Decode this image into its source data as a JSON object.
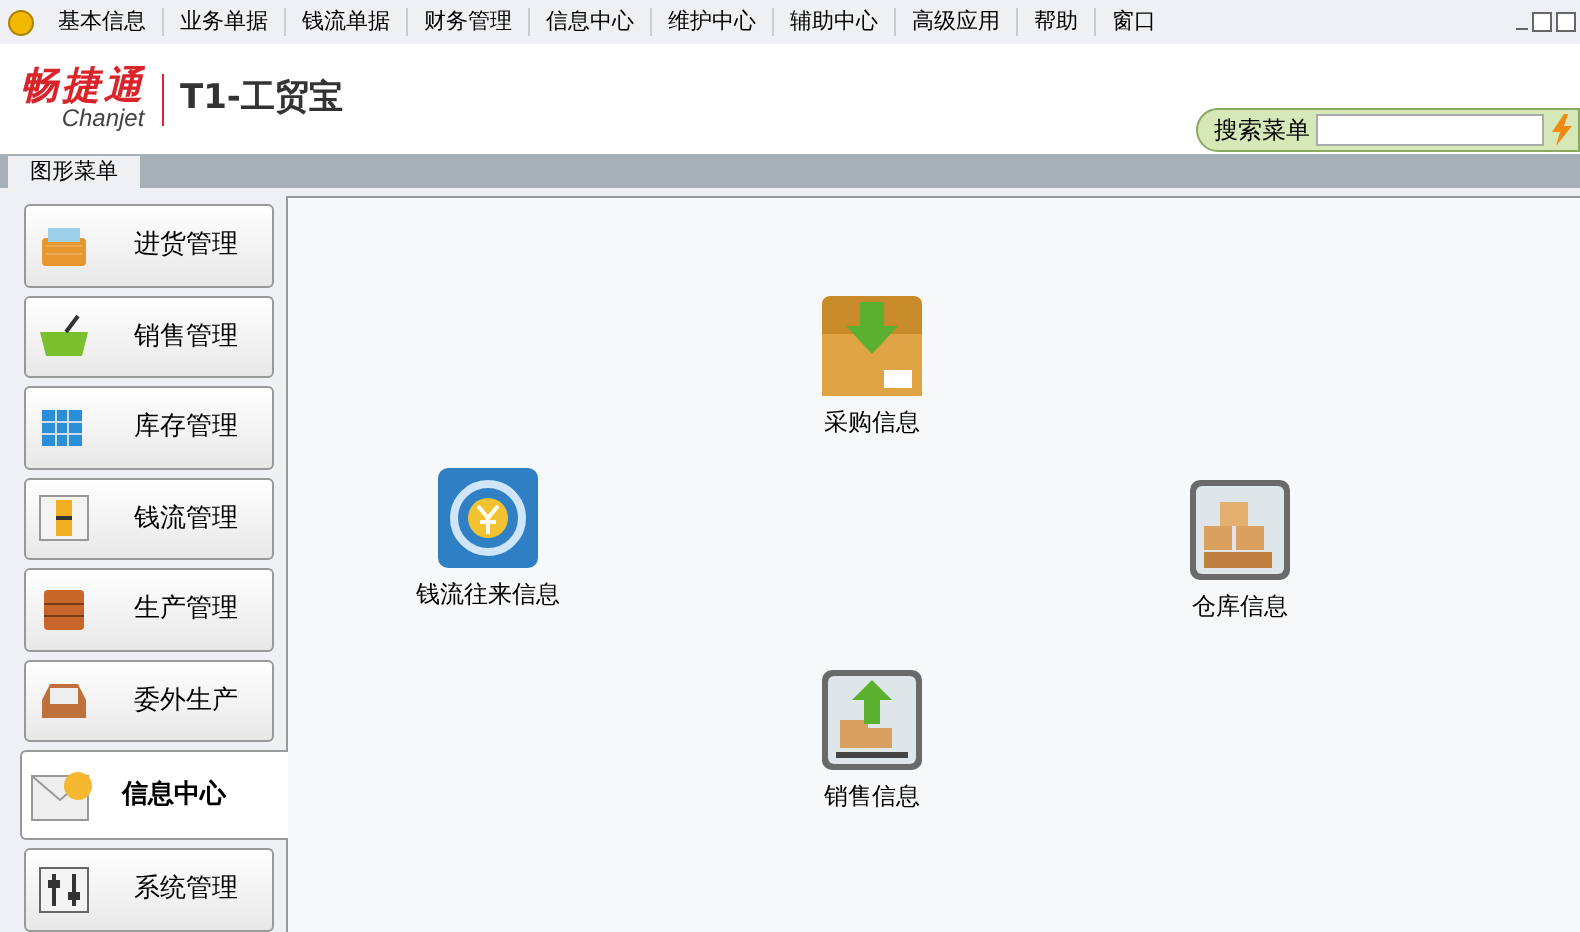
{
  "menu_bar": [
    {
      "label": "基本信息"
    },
    {
      "label": "业务单据"
    },
    {
      "label": "钱流单据"
    },
    {
      "label": "财务管理"
    },
    {
      "label": "信息中心"
    },
    {
      "label": "维护中心"
    },
    {
      "label": "辅助中心"
    },
    {
      "label": "高级应用"
    },
    {
      "label": "帮助"
    },
    {
      "label": "窗口"
    }
  ],
  "logo": {
    "brand": "畅捷通",
    "brand_en": "Chanjet",
    "product": "T1-工贸宝"
  },
  "search": {
    "label": "搜索菜单"
  },
  "tabs": [
    {
      "label": "图形菜单",
      "selected": true
    }
  ],
  "sidebar": {
    "items": [
      {
        "label": "进货管理",
        "kind": "basket",
        "selected": false
      },
      {
        "label": "销售管理",
        "kind": "cart",
        "selected": false
      },
      {
        "label": "库存管理",
        "kind": "grid",
        "selected": false
      },
      {
        "label": "钱流管理",
        "kind": "money",
        "selected": false
      },
      {
        "label": "生产管理",
        "kind": "drawer",
        "selected": false
      },
      {
        "label": "委外生产",
        "kind": "tray",
        "selected": false
      },
      {
        "label": "信息中心",
        "kind": "info",
        "selected": true
      },
      {
        "label": "系统管理",
        "kind": "sliders",
        "selected": false
      }
    ]
  },
  "canvas": {
    "nodes": [
      {
        "label": "采购信息",
        "kind": "purchase"
      },
      {
        "label": "钱流往来信息",
        "kind": "money"
      },
      {
        "label": "仓库信息",
        "kind": "warehouse"
      },
      {
        "label": "销售信息",
        "kind": "sales"
      }
    ]
  }
}
